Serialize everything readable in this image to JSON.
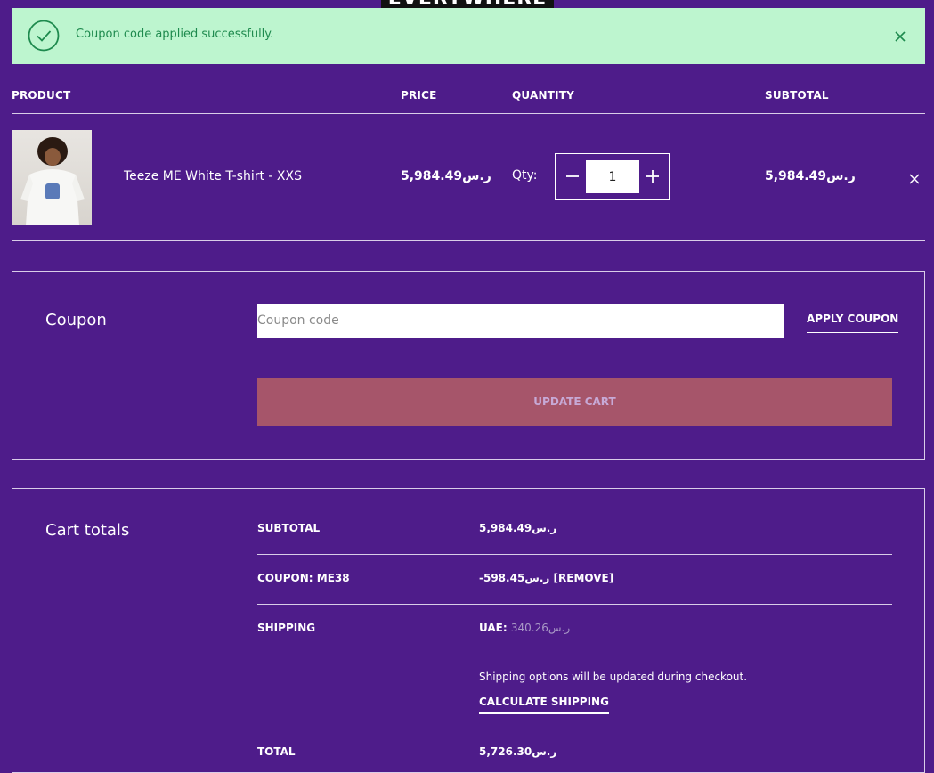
{
  "header": {
    "logo_text": "EVERYWHERE"
  },
  "notice": {
    "message": "Coupon code applied successfully.",
    "color": "#bdf5cf"
  },
  "table": {
    "headers": {
      "product": "PRODUCT",
      "price": "PRICE",
      "quantity": "QUANTITY",
      "subtotal": "SUBTOTAL"
    },
    "item": {
      "name": "Teeze ME White T-shirt - XXS",
      "price": "5,984.49ر.س",
      "qty_label": "Qty:",
      "qty_value": "1",
      "subtotal": "5,984.49ر.س"
    }
  },
  "coupon": {
    "title": "Coupon",
    "placeholder": "Coupon code",
    "apply_label": "APPLY COUPON",
    "update_label": "UPDATE CART"
  },
  "totals": {
    "title": "Cart totals",
    "subtotal_label": "SUBTOTAL",
    "subtotal_value": "5,984.49ر.س",
    "coupon_label": "COUPON: ME38",
    "coupon_value": "-598.45ر.س",
    "remove_label": "[REMOVE]",
    "shipping_label": "SHIPPING",
    "shipping_region": "UAE:",
    "shipping_value": "340.26ر.س",
    "shipping_note": "Shipping options will be updated during checkout.",
    "calc_label": "CALCULATE SHIPPING",
    "total_label": "TOTAL",
    "total_value": "5,726.30ر.س"
  },
  "colors": {
    "background": "#4e1c8a",
    "accent_success": "#1e8a4e",
    "update_button": "#a6556a"
  }
}
